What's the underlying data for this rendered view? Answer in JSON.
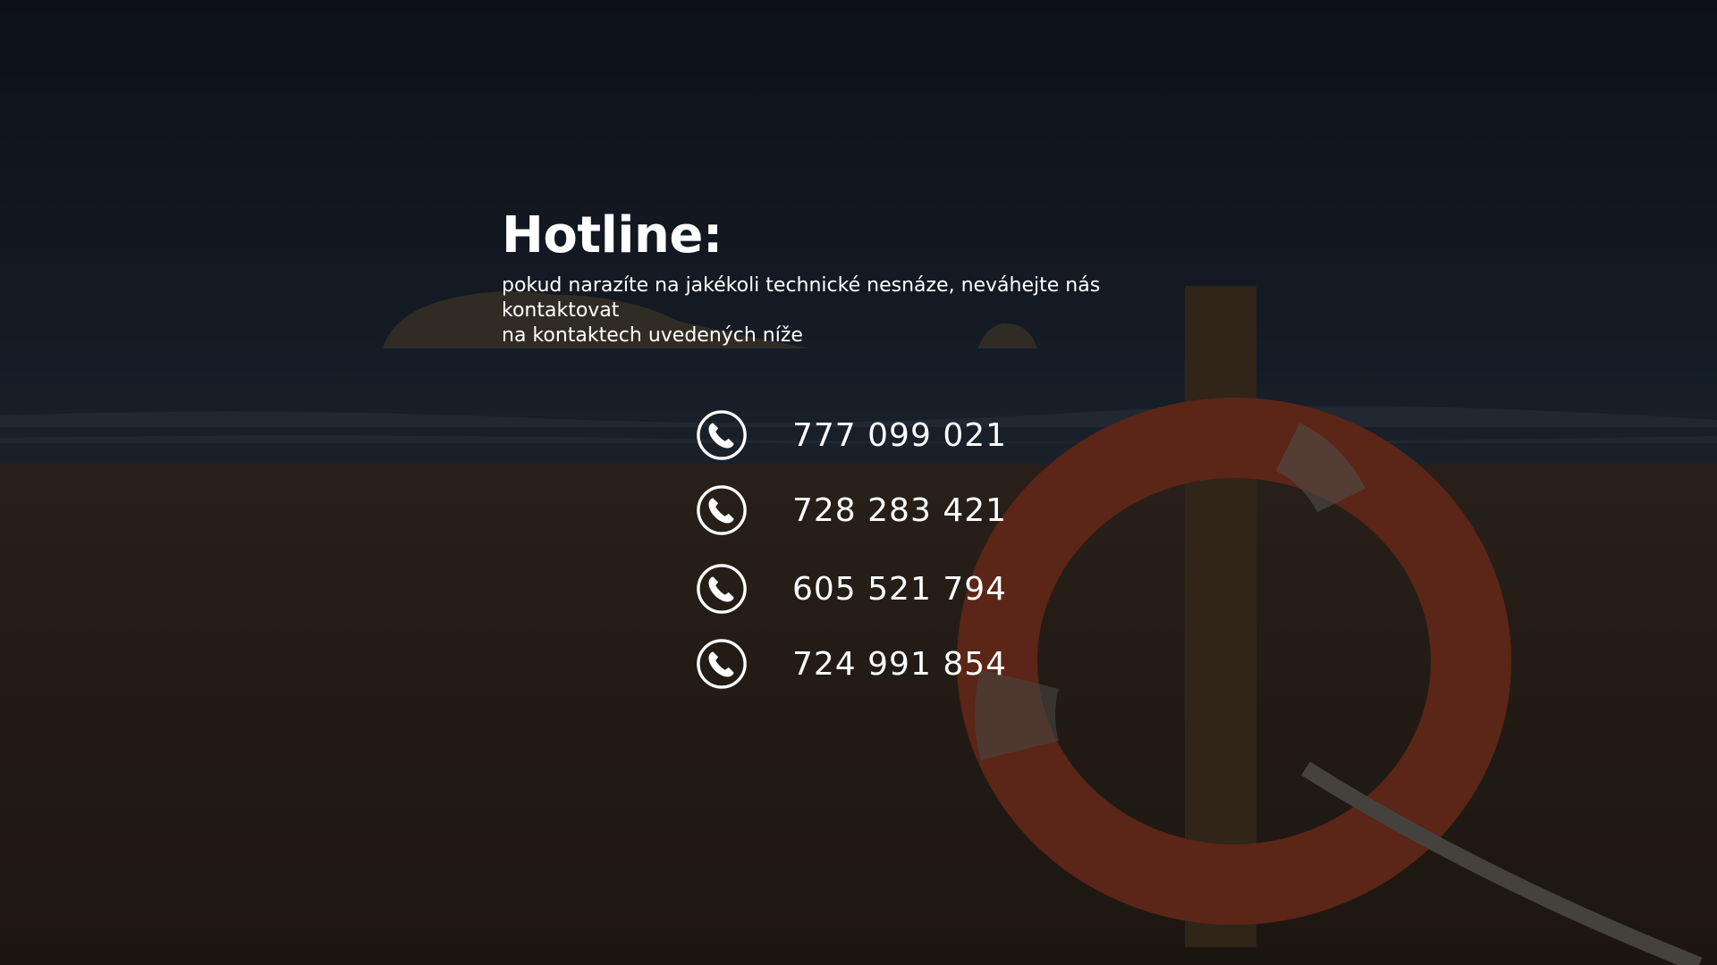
{
  "hotline": {
    "title": "Hotline:",
    "subtitle_line1": "pokud narazíte na jakékoli technické nesnáze, neváhejte nás kontaktovat",
    "subtitle_line2": "na kontaktech uvedených níže"
  },
  "phones": [
    {
      "number": "777 099 021",
      "icon": "phone-icon"
    },
    {
      "number": "728 283 421",
      "icon": "phone-icon"
    },
    {
      "number": "605 521 794",
      "icon": "phone-icon"
    },
    {
      "number": "724 991 854",
      "icon": "phone-icon"
    }
  ],
  "colors": {
    "text": "#ffffff",
    "sky": "#1a2030",
    "sea": "#26364a",
    "sand": "#3a2e22",
    "lifebuoy": "#a8432a"
  }
}
